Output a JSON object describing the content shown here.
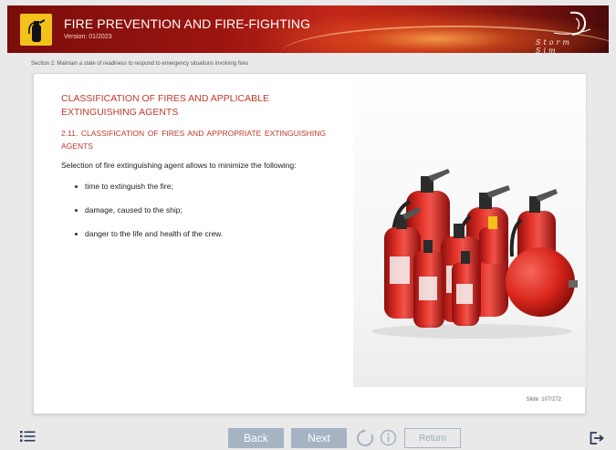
{
  "header": {
    "title": "FIRE PREVENTION AND FIRE-FIGHTING",
    "version": "Version: 01/2023",
    "logo_icon": "fire-extinguisher-icon",
    "brand_text": "Storm Sim"
  },
  "section": {
    "text": "Section 2: Maintain a state of readiness to respond to emergency situations involving fires"
  },
  "slide": {
    "heading": "CLASSIFICATION OF FIRES AND APPLICABLE EXTINGUISHING AGENTS",
    "subheading": "2.11. CLASSIFICATION OF FIRES AND APPROPRIATE EXTINGUISHING AGENTS",
    "paragraph": "Selection of fire extinguishing agent allows to minimize the following:",
    "bullets": [
      "time to extinguish the fire;",
      "damage, caused to the ship;",
      "danger to the life and health of the crew."
    ],
    "image": "fire-extinguishers-group-image",
    "counter": "Slide: 107/272"
  },
  "footer": {
    "menu_icon": "menu-list-icon",
    "back_label": "Back",
    "next_label": "Next",
    "reload_icon": "reload-icon",
    "info_icon": "info-icon",
    "return_label": "Return",
    "exit_icon": "exit-icon"
  },
  "colors": {
    "accent_red": "#c0392b",
    "header_red": "#9b1510",
    "logo_yellow": "#f2c21a",
    "button_blue_grey": "#a5b3c3"
  }
}
